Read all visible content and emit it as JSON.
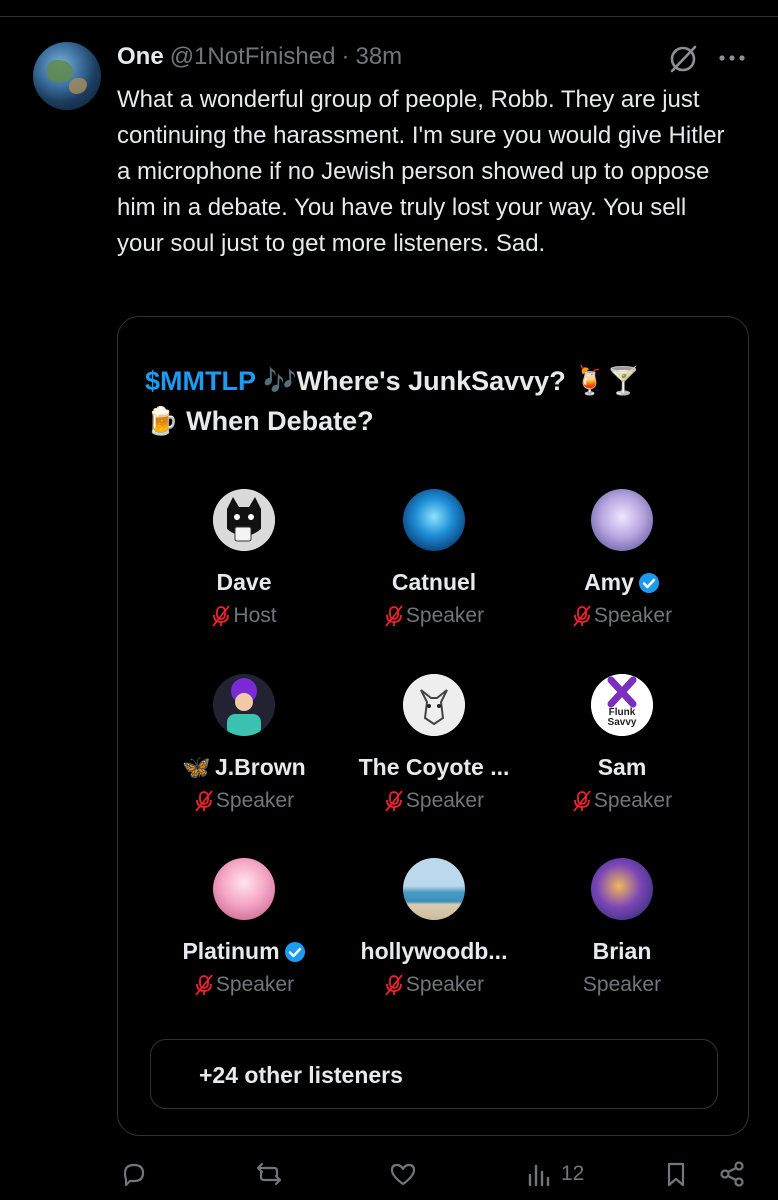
{
  "post": {
    "author_name": "One",
    "author_handle": "@1NotFinished",
    "separator": "·",
    "time": "38m",
    "text": "What a wonderful group of people, Robb. They are just continuing the harassment. I'm sure you would give Hitler a microphone if no Jewish person showed up to oppose him in a debate. You have truly lost your way. You sell your soul just to get more listeners. Sad.",
    "more_icon": "more-horizontal-icon",
    "grok_icon": "grok-icon"
  },
  "space": {
    "title_cashtag": "$MMTLP",
    "title_rest": "🎶Where's JunkSavvy? 🍹🍸",
    "title_line2": "🍺 When Debate?",
    "speakers": [
      {
        "name": "Dave",
        "role": "Host",
        "verified": false,
        "muted": true,
        "prefix": ""
      },
      {
        "name": "Catnuel",
        "role": "Speaker",
        "verified": false,
        "muted": true,
        "prefix": ""
      },
      {
        "name": "Amy",
        "role": "Speaker",
        "verified": true,
        "muted": true,
        "prefix": ""
      },
      {
        "name": "J.Brown",
        "role": "Speaker",
        "verified": false,
        "muted": true,
        "prefix": "🦋"
      },
      {
        "name": "The Coyote ...",
        "role": "Speaker",
        "verified": false,
        "muted": true,
        "prefix": ""
      },
      {
        "name": "Sam",
        "role": "Speaker",
        "verified": false,
        "muted": true,
        "prefix": ""
      },
      {
        "name": "Platinum",
        "role": "Speaker",
        "verified": true,
        "muted": true,
        "prefix": ""
      },
      {
        "name": "hollywoodb...",
        "role": "Speaker",
        "verified": false,
        "muted": true,
        "prefix": ""
      },
      {
        "name": "Brian",
        "role": "Speaker",
        "verified": false,
        "muted": false,
        "prefix": ""
      }
    ],
    "sam_avatar_text": "Flunk Savvy",
    "listeners_label": "+24 other listeners"
  },
  "actions": {
    "reply_icon": "reply-icon",
    "repost_icon": "repost-icon",
    "like_icon": "like-icon",
    "views_icon": "views-icon",
    "views_count": "12",
    "bookmark_icon": "bookmark-icon",
    "share_icon": "share-icon"
  },
  "colors": {
    "background": "#000000",
    "accent": "#1d9bf0",
    "muted_mic": "#f4212e",
    "secondary_text": "#71767b"
  }
}
